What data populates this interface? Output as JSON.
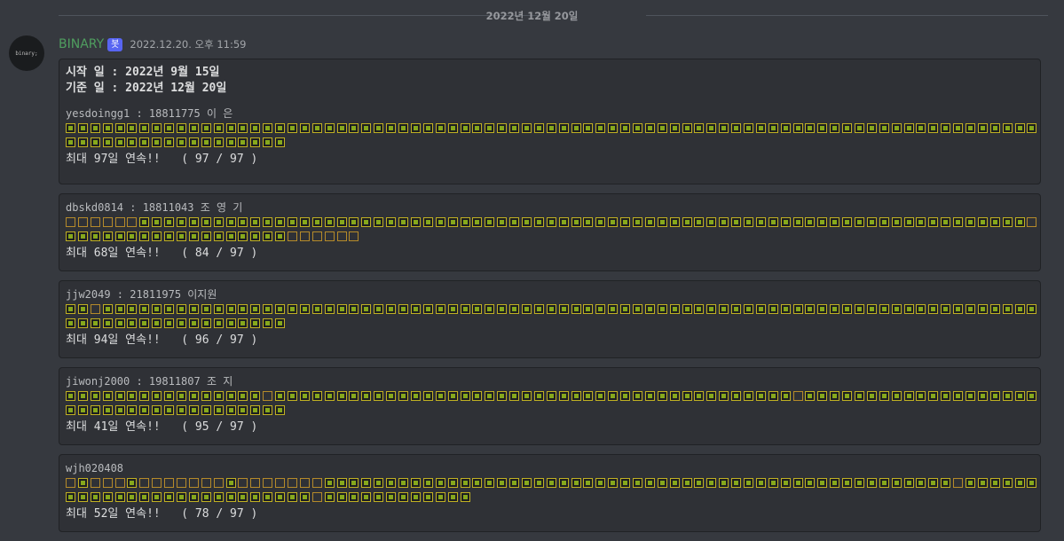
{
  "date_divider": "2022년 12월 20일",
  "avatar_text": "binary;",
  "message": {
    "username": "BINARY",
    "bot_tag": "봇",
    "timestamp": "2022.12.20. 오후 11:59"
  },
  "header": {
    "start_line": "시작 일 : 2022년 9월 15일",
    "base_line": "기준 일 : 2022년 12월 20일"
  },
  "cards": [
    {
      "user": "yesdoingg1 : 18811775 이 은 ",
      "summary": "최대 97일 연속!!   ( 97 / 97 )",
      "cells": "1111111111111111111111111111111111111111111111111111111111111111111111111111111111111111111111111"
    },
    {
      "user": "dbskd0814 : 18811043 조 영 기",
      "summary": "최대 68일 연속!!   ( 84 / 97 )",
      "cells": "0000001111111111111111111111111111111111111111111111111111111111111111111111110111111111111111111000000"
    },
    {
      "user": "jjw2049 : 21811975 이지원",
      "summary": "최대 94일 연속!!   ( 96 / 97 )",
      "cells": "1101111111111111111111111111111111111111111111111111111111111111111111111111111111111111111111111"
    },
    {
      "user": "jiwonj2000 : 19811807 조 지",
      "summary": "최대 41일 연속!!   ( 95 / 97 )",
      "cells": "1111111111111111011111111111111111111111111111111111111111101111111111111111111111111111111111111"
    },
    {
      "user": "wjh020408",
      "summary": "최대 52일 연속!!   ( 78 / 97 )",
      "cells": "0100010000000100000001111111111111111111111111111111111111111111111111110111111111111111111111111110111111111111"
    }
  ],
  "colors": {
    "background": "#36393f",
    "codeblock_bg": "#2f3136",
    "username": "#4f9e5f",
    "bot_tag": "#5865f2",
    "square_on": "#86a81c",
    "square_off_border": "#b58a2a"
  }
}
